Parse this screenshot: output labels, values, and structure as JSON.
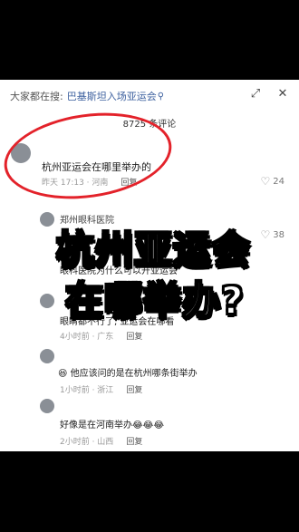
{
  "search": {
    "label": "大家都在搜:",
    "term": "巴基斯坦入场亚运会"
  },
  "comment_count": "8725 条评论",
  "overlay": {
    "line1": "杭州亚运会",
    "line2": "在哪举办?"
  },
  "comments": [
    {
      "text": "杭州亚运会在哪里举办的",
      "time": "昨天 17:13 · 河南",
      "reply": "回复",
      "likes": "24"
    },
    {
      "username": "郑州眼科医院",
      "text": "眼科医院为什么可以开亚运会",
      "likes": "38"
    },
    {
      "text": "眼睛都不行了, 亚运会在哪看",
      "time": "4小时前 · 广东",
      "reply": "回复"
    },
    {
      "text": "他应该问的是在杭州哪条街举办",
      "time": "1小时前 · 浙江",
      "reply": "回复"
    },
    {
      "text": "好像是在河南举办",
      "time": "2小时前 · 山西",
      "reply": "回复"
    }
  ],
  "colors": {
    "accent_red": "#e3222a",
    "link_blue": "#3b5f9e"
  }
}
